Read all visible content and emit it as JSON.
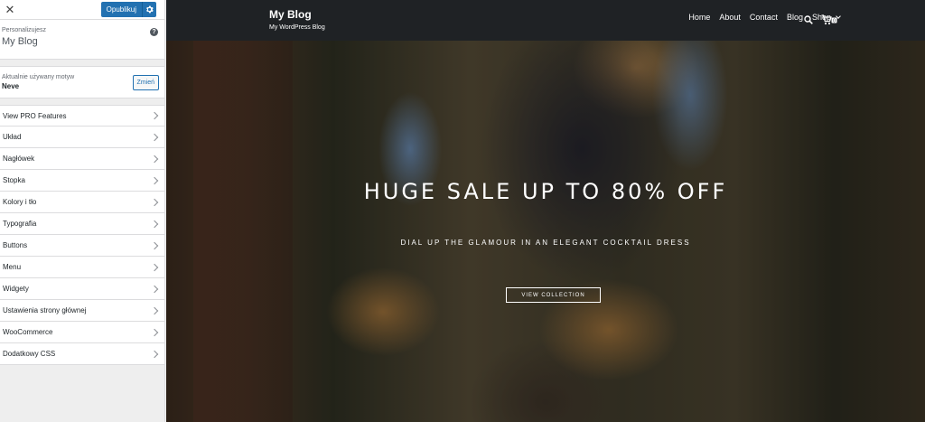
{
  "sidebar": {
    "close_glyph": "✕",
    "publish_label": "Opublikuj",
    "customizing_label": "Personalizujesz",
    "site_name": "My Blog",
    "help_glyph": "?",
    "active_theme_label": "Aktualnie używany motyw",
    "theme_name": "Neve",
    "change_label": "Zmień",
    "items": [
      {
        "label": "View PRO Features"
      },
      {
        "label": "Układ"
      },
      {
        "label": "Nagłówek"
      },
      {
        "label": "Stopka"
      },
      {
        "label": "Kolory i tło"
      },
      {
        "label": "Typografia"
      },
      {
        "label": "Buttons"
      },
      {
        "label": "Menu"
      },
      {
        "label": "Widgety"
      },
      {
        "label": "Ustawienia strony głównej"
      },
      {
        "label": "WooCommerce"
      },
      {
        "label": "Dodatkowy CSS"
      }
    ]
  },
  "preview": {
    "site_title": "My Blog",
    "tagline": "My WordPress Blog",
    "nav": {
      "home": "Home",
      "about": "About",
      "contact": "Contact",
      "blog": "Blog",
      "shop": "Shop"
    },
    "cart_count": "0",
    "hero": {
      "title": "HUGE SALE UP TO 80% OFF",
      "subtitle": "DIAL UP THE GLAMOUR IN AN ELEGANT COCKTAIL DRESS",
      "button": "VIEW COLLECTION"
    }
  },
  "colors": {
    "accent": "#2271b1",
    "header_bg": "#1f2225"
  }
}
